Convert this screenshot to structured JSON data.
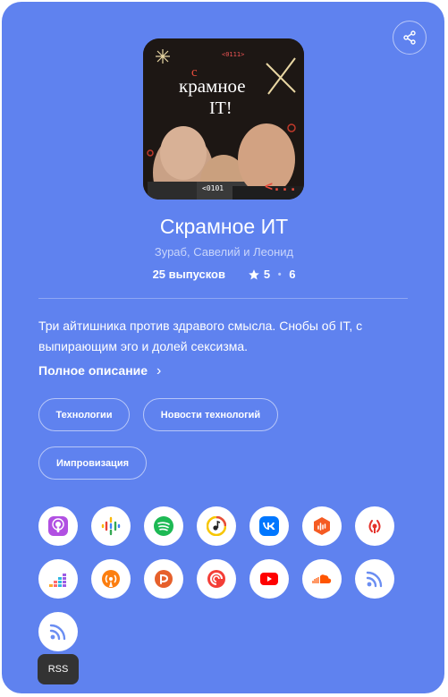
{
  "podcast": {
    "title": "Скрамное ИТ",
    "authors": "Зураб, Савелий и Леонид",
    "episodes": "25 выпусков",
    "rating": "5",
    "rating_separator": "•",
    "rating_count": "6",
    "description": "Три айтишника против здравого смысла. Снобы об IT, с выпирающим эго и долей сексизма.",
    "full_description_link": "Полное описание",
    "full_description_chevron": "›",
    "tags": [
      "Технологии",
      "Новости технологий",
      "Импровизация"
    ]
  },
  "cover": {
    "title_small": "с",
    "title_line1": "крамное",
    "title_line2": "IT!",
    "code_top": "<0111>",
    "code_bottom": "<0101",
    "code_arrow": "<..."
  },
  "platforms": [
    {
      "name": "apple-podcasts-icon",
      "color": "#b150e2"
    },
    {
      "name": "google-podcasts-icon",
      "color": "#4285f4"
    },
    {
      "name": "spotify-icon",
      "color": "#1db954"
    },
    {
      "name": "yandex-music-icon",
      "color": "#f7c600"
    },
    {
      "name": "vk-icon",
      "color": "#0077ff"
    },
    {
      "name": "castbox-icon",
      "color": "#f55b23"
    },
    {
      "name": "podcast-addict-icon",
      "color": "#e4322b"
    },
    {
      "name": "deezer-icon",
      "color": "#ef5466"
    },
    {
      "name": "overcast-icon",
      "color": "#fc7e0f"
    },
    {
      "name": "player-fm-icon",
      "color": "#e6602b"
    },
    {
      "name": "pocket-casts-icon",
      "color": "#f43e37"
    },
    {
      "name": "youtube-icon",
      "color": "#ff0000"
    },
    {
      "name": "soundcloud-icon",
      "color": "#ff5500"
    },
    {
      "name": "rss-feed-icon",
      "color": "#6b8ef2"
    },
    {
      "name": "rss-icon",
      "color": "#6b8ef2"
    }
  ],
  "tooltip": "RSS"
}
